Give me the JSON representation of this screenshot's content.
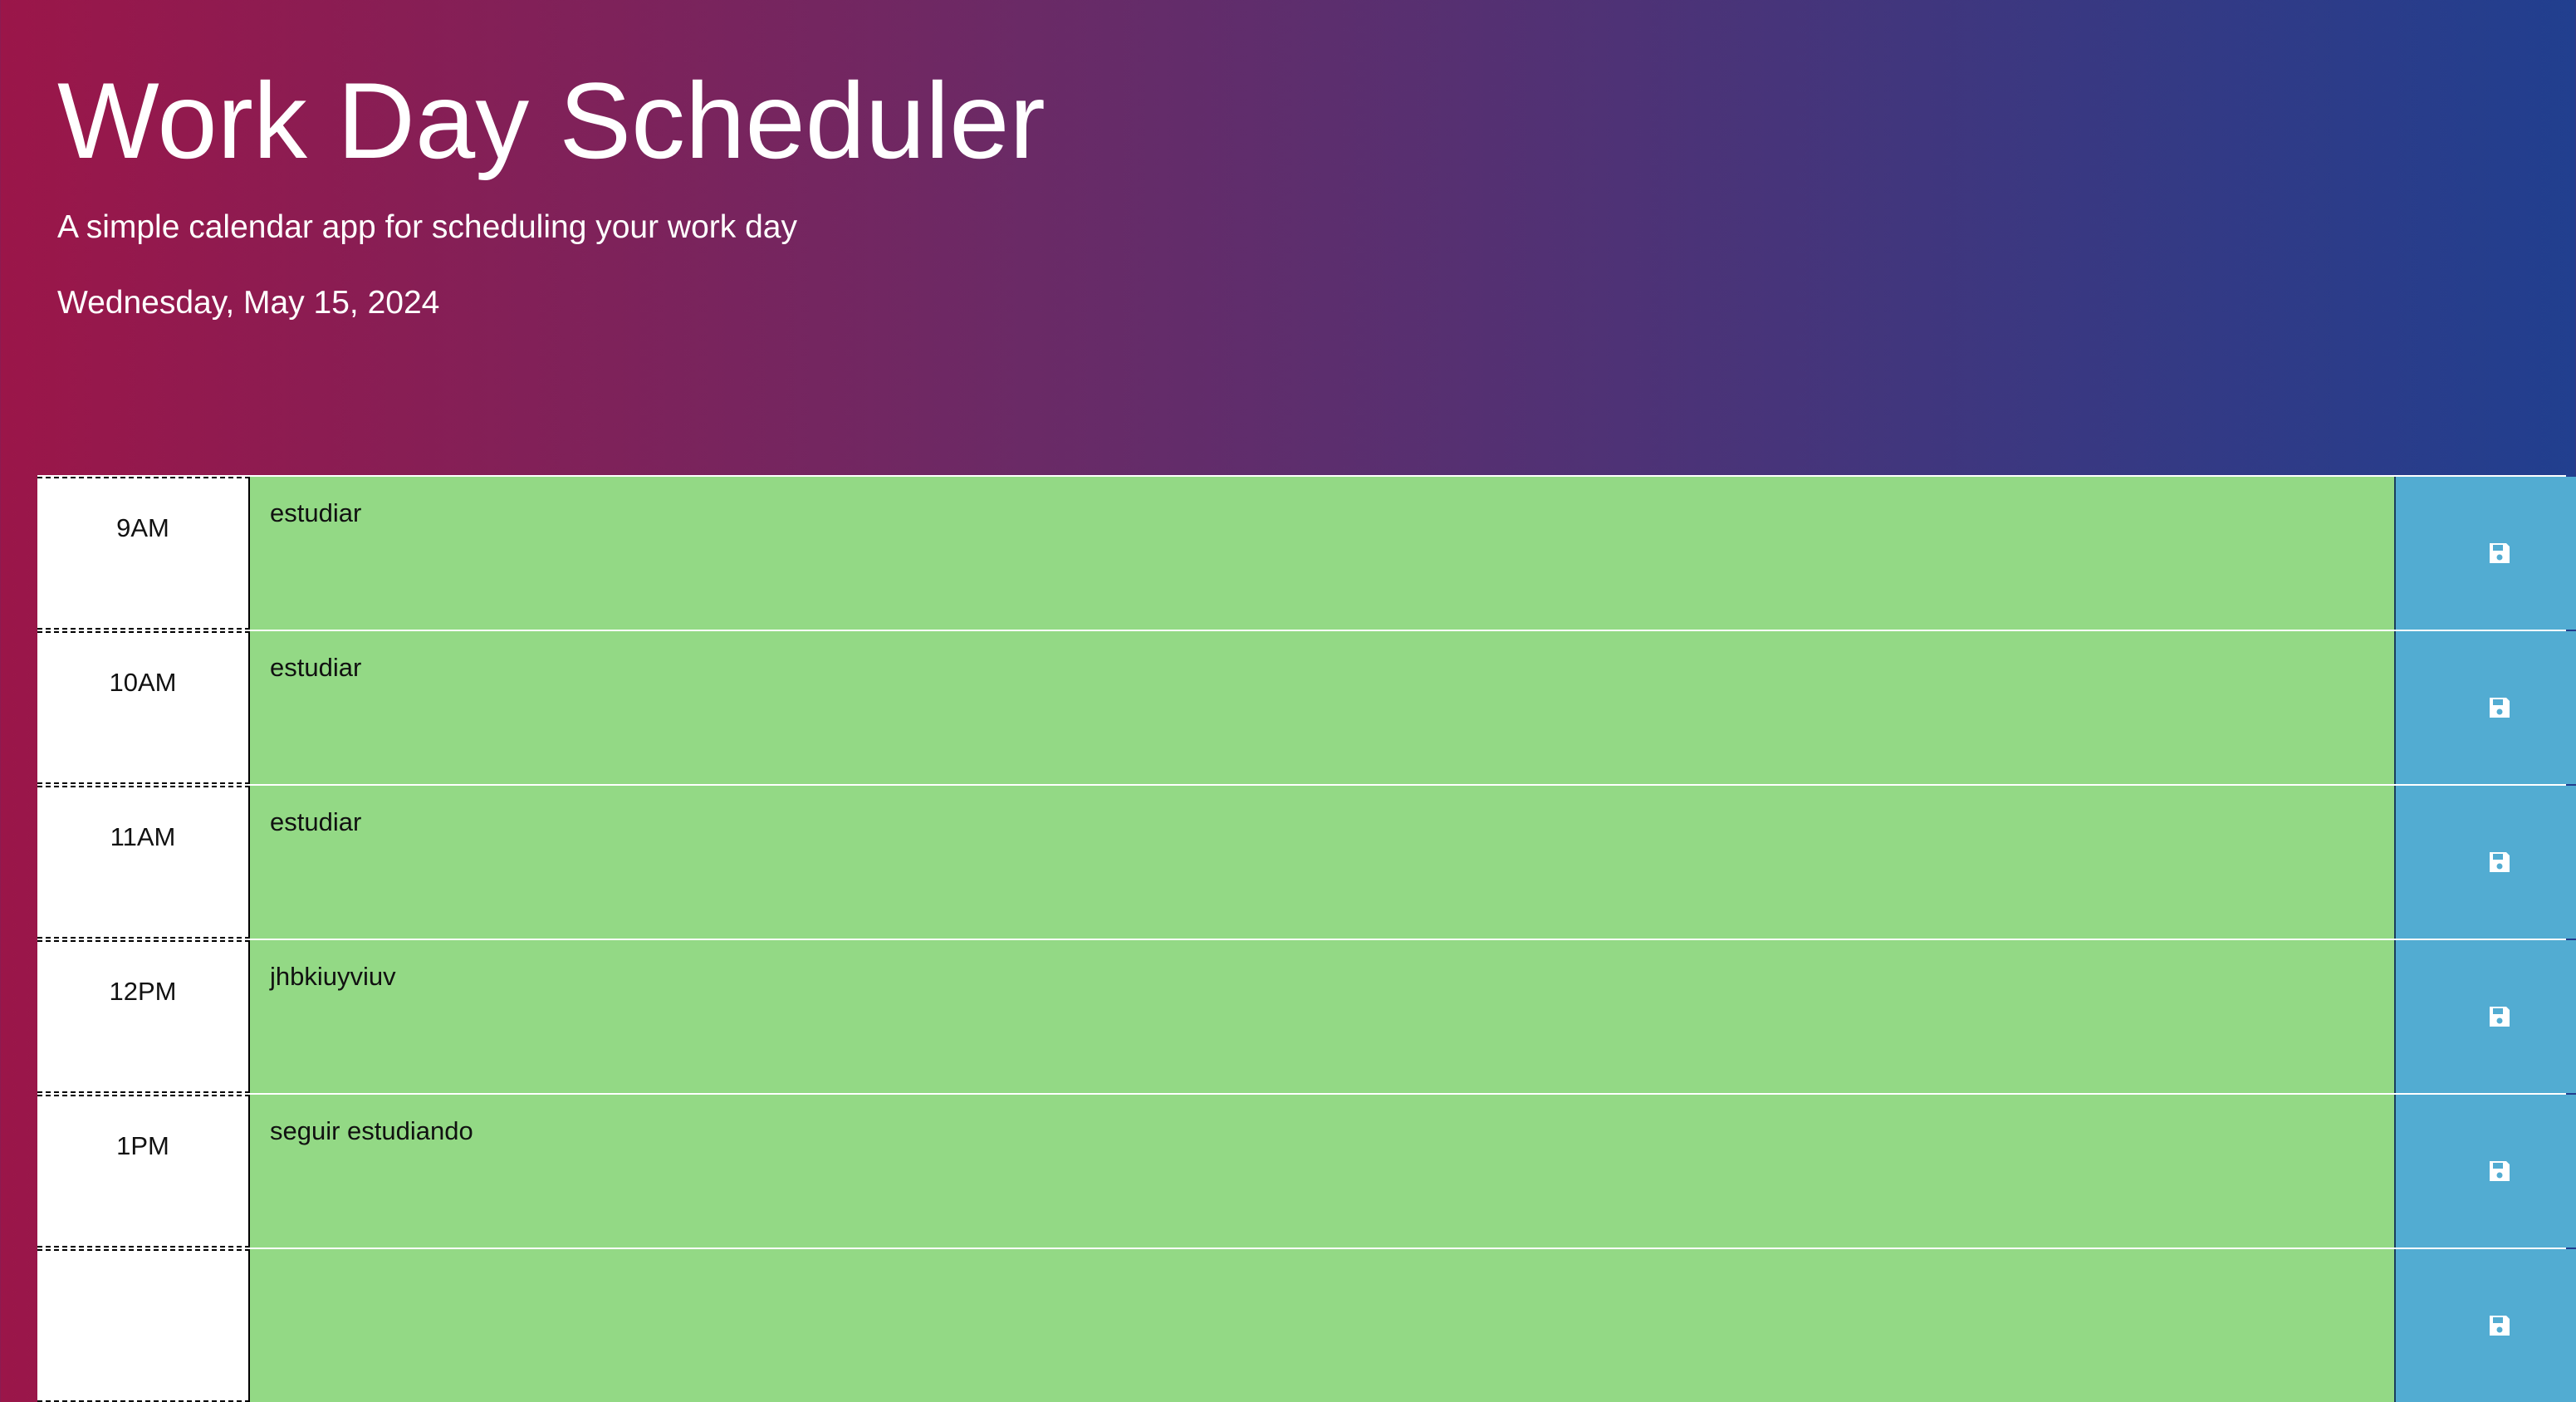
{
  "header": {
    "title": "Work Day Scheduler",
    "subtitle": "A simple calendar app for scheduling your work day",
    "date": "Wednesday, May 15, 2024"
  },
  "rows": [
    {
      "hour": "9AM",
      "text": "estudiar"
    },
    {
      "hour": "10AM",
      "text": "estudiar"
    },
    {
      "hour": "11AM",
      "text": "estudiar"
    },
    {
      "hour": "12PM",
      "text": "jhbkiuyviuv"
    },
    {
      "hour": "1PM",
      "text": "seguir estudiando"
    },
    {
      "hour": "",
      "text": ""
    }
  ],
  "colors": {
    "present_or_future": "#93d985",
    "save_button": "#52acd2",
    "background_left": "#9b1649",
    "background_right": "#213f8f"
  },
  "icons": {
    "save": "floppy-disk-icon"
  }
}
